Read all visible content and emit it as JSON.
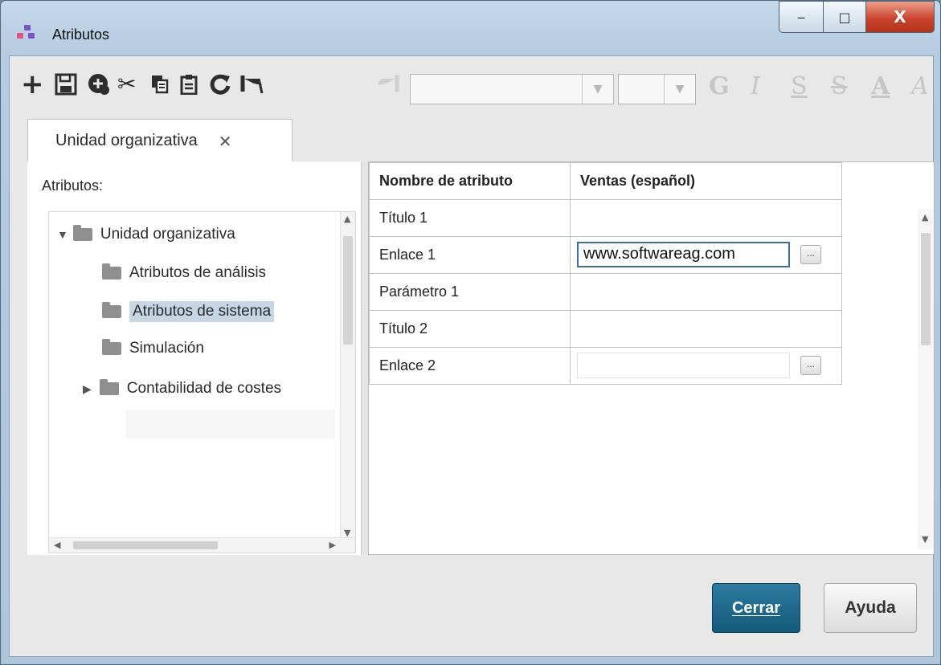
{
  "window": {
    "title": "Atributos",
    "minimize_glyph": "‒",
    "maximize_glyph": "□",
    "close_glyph": "X"
  },
  "toolbar": {
    "icons": [
      "plus-icon",
      "save-icon",
      "add-object-icon",
      "cut-icon",
      "copy-icon",
      "paste-icon",
      "refresh-icon",
      "undo-icon",
      "redo-icon"
    ],
    "font_combo_value": "",
    "size_combo_value": "",
    "format_letters": [
      "G",
      "I",
      "S",
      "S",
      "A",
      "A"
    ]
  },
  "tab": {
    "label": "Unidad organizativa",
    "close_glyph": "✕"
  },
  "left": {
    "label": "Atributos:",
    "tree": [
      {
        "label": "Unidad organizativa",
        "expander": "▼"
      },
      {
        "label": "Atributos de análisis"
      },
      {
        "label": "Atributos de sistema",
        "selected": true
      },
      {
        "label": "Simulación"
      },
      {
        "label": "Contabilidad de costes",
        "expander": "▶"
      }
    ]
  },
  "grid": {
    "headers": [
      "Nombre de atributo",
      "Ventas (español)"
    ],
    "rows": [
      {
        "name": "Título 1",
        "value": ""
      },
      {
        "name": "Enlace 1",
        "value": "www.softwareag.com",
        "button": "..."
      },
      {
        "name": "Parámetro 1",
        "value": ""
      },
      {
        "name": "Título 2",
        "value": ""
      },
      {
        "name": "Enlace 2",
        "value": "",
        "button": "..."
      }
    ]
  },
  "footer": {
    "close_label": "Cerrar",
    "help_label": "Ayuda"
  },
  "colors": {
    "accent": "#1a6488",
    "selection": "#c7d6e4",
    "close_button": "#c9452e"
  }
}
